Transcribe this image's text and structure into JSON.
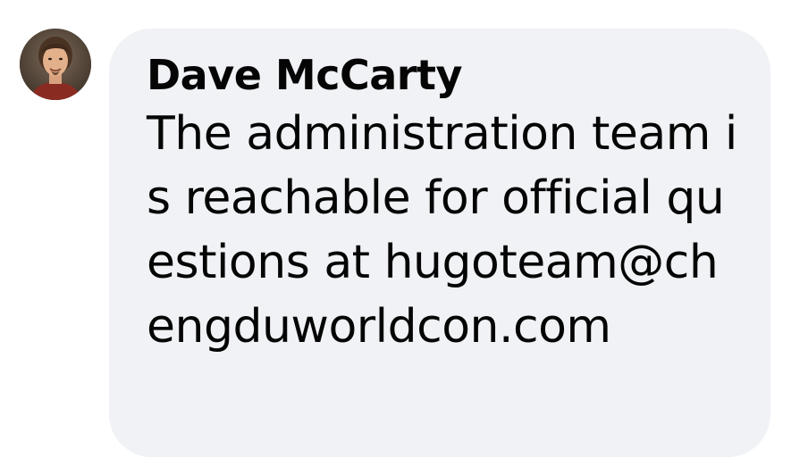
{
  "comment": {
    "author": "Dave McCarty",
    "text": "The administration team is reachable for official questions at hugoteam@chengduworldcon.com",
    "avatar_icon": "profile-photo-icon"
  },
  "colors": {
    "bubble_background": "#f0f2f5",
    "text": "#050505",
    "page_background": "#ffffff"
  }
}
